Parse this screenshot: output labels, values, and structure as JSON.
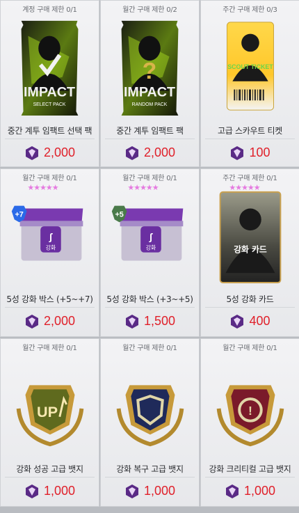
{
  "items": [
    {
      "limit": "계정 구매 제한 0/1",
      "name": "중간 계투 임팩트 선택 팩",
      "price": "2,000",
      "pack_title": "IMPACT",
      "pack_sub": "SELECT PACK"
    },
    {
      "limit": "월간 구매 제한 0/2",
      "name": "중간 계투 임팩트 팩",
      "price": "2,000",
      "pack_title": "IMPACT",
      "pack_sub": "RANDOM PACK"
    },
    {
      "limit": "주간 구매 제한 0/3",
      "name": "고급 스카우트 티켓",
      "price": "100",
      "ticket_text": "SCOUT TICKET"
    },
    {
      "limit": "월간 구매 제한 0/1",
      "name": "5성 강화 박스 (+5~+7)",
      "price": "2,000",
      "box_badge": "+7",
      "box_label": "강화"
    },
    {
      "limit": "월간 구매 제한 0/1",
      "name": "5성 강화 박스 (+3~+5)",
      "price": "1,500",
      "box_badge": "+5",
      "box_label": "강화"
    },
    {
      "limit": "주간 구매 제한 0/1",
      "name": "5성 강화 카드",
      "price": "400",
      "card_text": "강화 카드"
    },
    {
      "limit": "월간 구매 제한 0/1",
      "name": "강화 성공 고급 뱃지",
      "price": "1,000",
      "badge_text": "UP"
    },
    {
      "limit": "월간 구매 제한 0/1",
      "name": "강화 복구 고급 뱃지",
      "price": "1,000"
    },
    {
      "limit": "월간 구매 제한 0/1",
      "name": "강화 크리티컬 고급 뱃지",
      "price": "1,000"
    }
  ],
  "colors": {
    "price": "#e0202a",
    "gem": "#5a2a86"
  },
  "icons": {
    "currency": "gem-icon"
  }
}
